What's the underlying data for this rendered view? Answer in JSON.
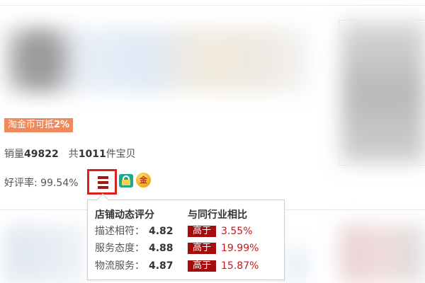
{
  "promo": {
    "prefix": "淘金币可抵",
    "percent": "2%"
  },
  "sales": {
    "sold_label": "销量",
    "sold_count": "49822",
    "items_prefix": "共",
    "items_count": "1011",
    "items_suffix": "件宝贝"
  },
  "rating": {
    "text": "好评率: 99.54%"
  },
  "badges": [
    {
      "icon": "shopping-bag-icon",
      "color": "#1fa88f"
    },
    {
      "icon": "gold-medal-icon",
      "text": "金",
      "color": "#f0a918"
    }
  ],
  "dsr_popup": {
    "title": "店铺动态评分",
    "compare_title": "与同行业相比",
    "rows": [
      {
        "label": "描述相符：",
        "score": "4.82",
        "compare": "高于",
        "percent": "3.55%"
      },
      {
        "label": "服务态度：",
        "score": "4.88",
        "compare": "高于",
        "percent": "19.99%"
      },
      {
        "label": "物流服务：",
        "score": "4.87",
        "compare": "高于",
        "percent": "15.87%"
      }
    ]
  },
  "colors": {
    "promo_bg": "#f08a5d",
    "accent_red": "#d9221b",
    "compare_bg": "#a30d0d",
    "percent_text": "#c61a1a"
  }
}
